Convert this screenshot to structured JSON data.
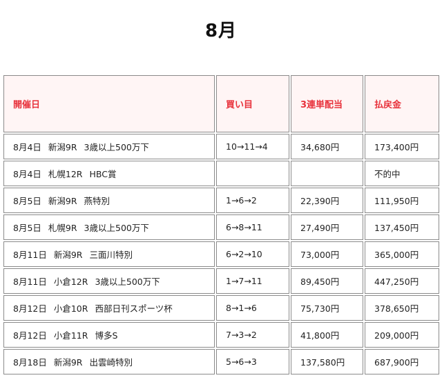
{
  "page": {
    "title": "8月"
  },
  "table": {
    "headers": [
      "開催日",
      "買い目",
      "3連単配当",
      "払戻金"
    ],
    "rows": [
      {
        "date": "8月4日",
        "venue": "新潟9R",
        "race": "3歳以上500万下",
        "ticket": "10→11→4",
        "dividend": "34,680円",
        "payout": "173,400円"
      },
      {
        "date": "8月4日",
        "venue": "札幌12R",
        "race": "HBC賞",
        "ticket": "",
        "dividend": "",
        "payout": "不的中"
      },
      {
        "date": "8月5日",
        "venue": "新潟9R",
        "race": "燕特別",
        "ticket": "1→6→2",
        "dividend": "22,390円",
        "payout": "111,950円"
      },
      {
        "date": "8月5日",
        "venue": "札幌9R",
        "race": "3歳以上500万下",
        "ticket": "6→8→11",
        "dividend": "27,490円",
        "payout": "137,450円"
      },
      {
        "date": "8月11日",
        "venue": "新潟9R",
        "race": "三面川特別",
        "ticket": "6→2→10",
        "dividend": "73,000円",
        "payout": "365,000円"
      },
      {
        "date": "8月11日",
        "venue": "小倉12R",
        "race": "3歳以上500万下",
        "ticket": "1→7→11",
        "dividend": "89,450円",
        "payout": "447,250円"
      },
      {
        "date": "8月12日",
        "venue": "小倉10R",
        "race": "西部日刊スポーツ杯",
        "ticket": "8→1→6",
        "dividend": "75,730円",
        "payout": "378,650円"
      },
      {
        "date": "8月12日",
        "venue": "小倉11R",
        "race": "博多S",
        "ticket": "7→3→2",
        "dividend": "41,800円",
        "payout": "209,000円"
      },
      {
        "date": "8月18日",
        "venue": "新潟9R",
        "race": "出雲崎特別",
        "ticket": "5→6→3",
        "dividend": "137,580円",
        "payout": "687,900円"
      }
    ]
  }
}
